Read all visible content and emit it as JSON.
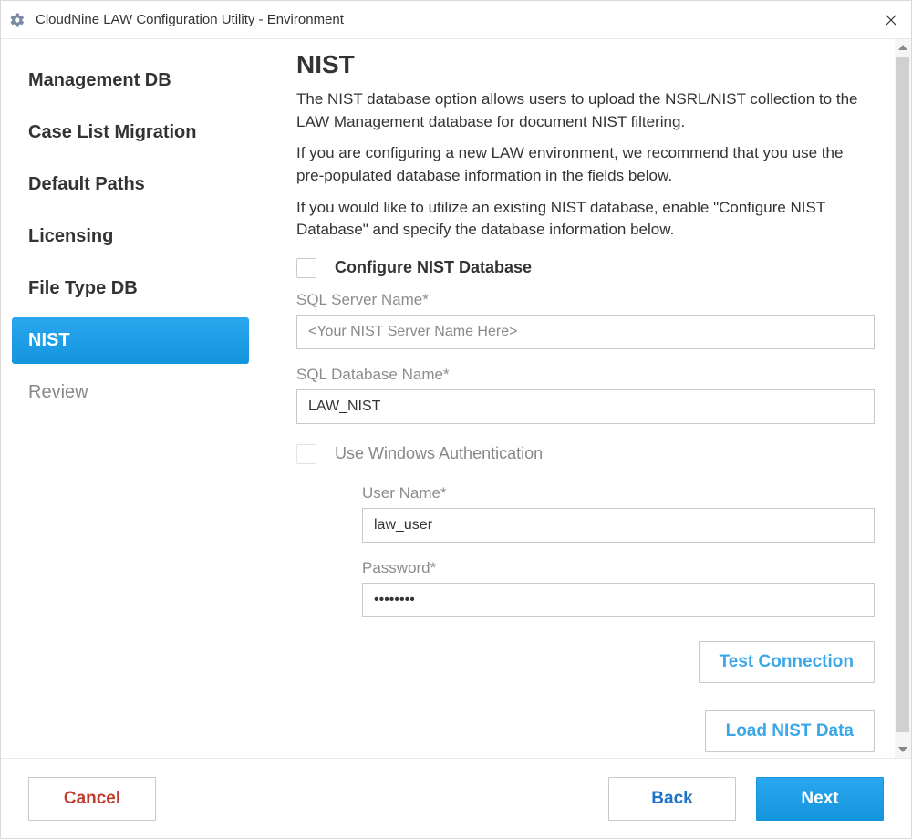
{
  "window": {
    "title": "CloudNine LAW Configuration Utility - Environment"
  },
  "sidebar": {
    "items": [
      {
        "label": "Management DB",
        "selected": false,
        "enabled": true
      },
      {
        "label": "Case List Migration",
        "selected": false,
        "enabled": true
      },
      {
        "label": "Default Paths",
        "selected": false,
        "enabled": true
      },
      {
        "label": "Licensing",
        "selected": false,
        "enabled": true
      },
      {
        "label": "File Type DB",
        "selected": false,
        "enabled": true
      },
      {
        "label": "NIST",
        "selected": true,
        "enabled": true
      },
      {
        "label": "Review",
        "selected": false,
        "enabled": false
      }
    ]
  },
  "page": {
    "heading": "NIST",
    "paragraphs": [
      "The NIST database option allows users to upload the NSRL/NIST collection to the LAW Management database for document NIST filtering.",
      "If you are configuring a new LAW environment, we recommend that you use the pre-populated database information in the fields below.",
      "If you would like to utilize an existing NIST database, enable \"Configure NIST Database\" and specify the database information below."
    ],
    "configure_checkbox_label": "Configure NIST Database",
    "sql_server_label": "SQL Server Name*",
    "sql_server_value": "<Your NIST Server Name Here>",
    "sql_db_label": "SQL Database Name*",
    "sql_db_value": "LAW_NIST",
    "winauth_checkbox_label": "Use Windows Authentication",
    "username_label": "User Name*",
    "username_value": "law_user",
    "password_label": "Password*",
    "password_value": "••••••••",
    "test_connection_label": "Test Connection",
    "load_nist_label": "Load NIST Data"
  },
  "footer": {
    "cancel": "Cancel",
    "back": "Back",
    "next": "Next"
  }
}
